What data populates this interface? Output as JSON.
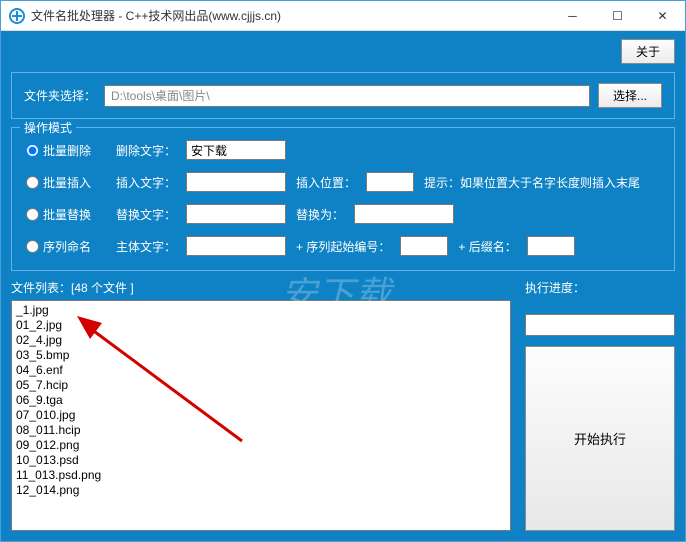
{
  "titlebar": {
    "title": "文件名批处理器 - C++技术网出品(www.cjjjs.cn)"
  },
  "about_label": "关于",
  "folder": {
    "label": "文件夹选择：",
    "path": "D:\\tools\\桌面\\图片\\",
    "browse_label": "选择..."
  },
  "mode": {
    "legend": "操作模式",
    "delete": {
      "radio": "批量删除",
      "label": "删除文字：",
      "value": "安下载"
    },
    "insert": {
      "radio": "批量插入",
      "label": "插入文字：",
      "pos_label": "插入位置：",
      "hint": "提示：如果位置大于名字长度则插入末尾"
    },
    "replace": {
      "radio": "批量替换",
      "label": "替换文字：",
      "to_label": "替换为："
    },
    "sequence": {
      "radio": "序列命名",
      "label": "主体文字：",
      "start_label": "+ 序列起始编号：",
      "suffix_label": "+ 后缀名："
    }
  },
  "filelist": {
    "label_prefix": "文件列表：[",
    "count": "48",
    "label_suffix": " 个文件 ]",
    "items": [
      "_1.jpg",
      "01_2.jpg",
      "02_4.jpg",
      "03_5.bmp",
      "04_6.enf",
      "05_7.hcip",
      "06_9.tga",
      "07_010.jpg",
      "08_011.hcip",
      "09_012.png",
      "10_013.psd",
      "11_013.psd.png",
      "12_014.png"
    ]
  },
  "progress_label": "执行进度：",
  "start_label": "开始执行",
  "watermark": "安下载 anxz.com"
}
